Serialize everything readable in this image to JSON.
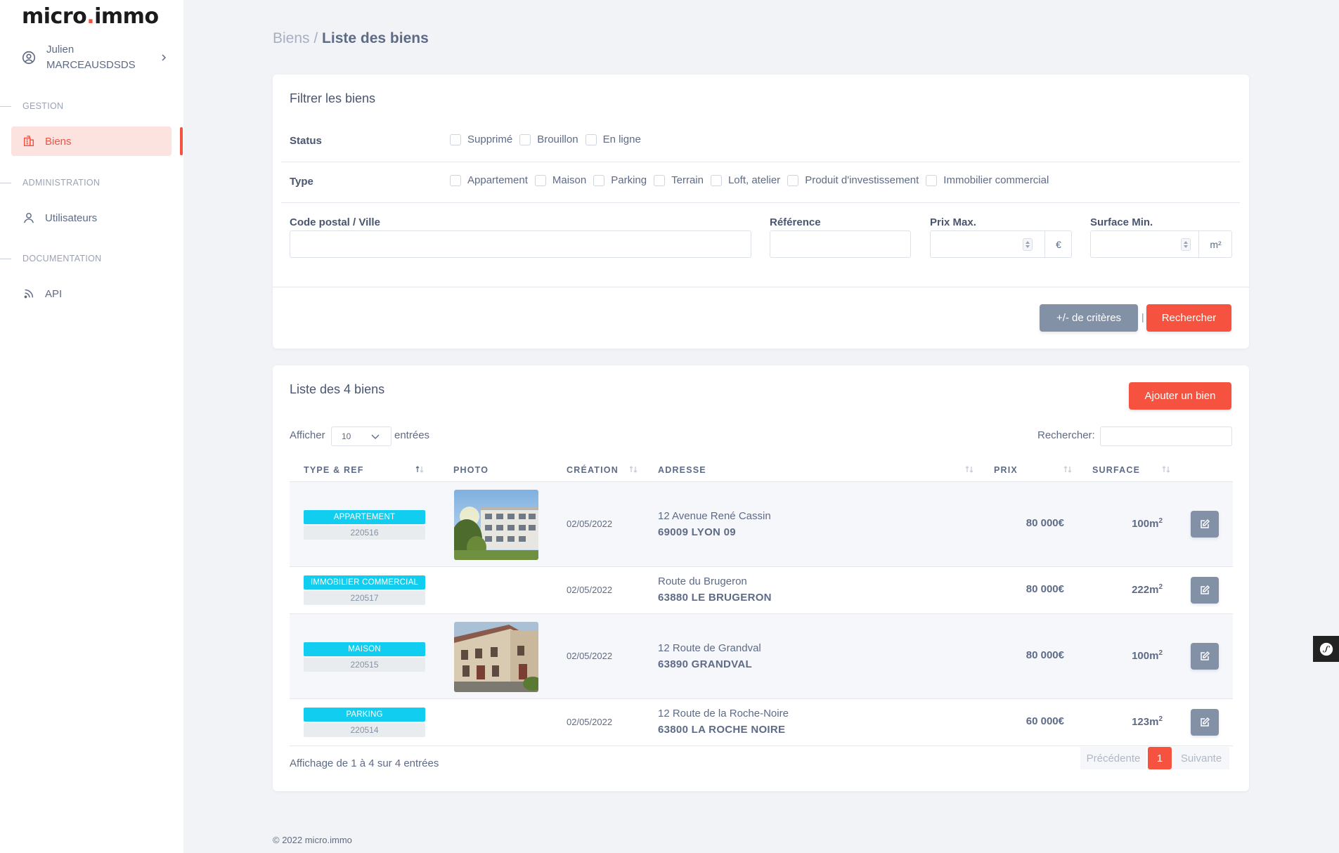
{
  "app": {
    "logo_main": "micro",
    "logo_dot": ".",
    "logo_tail": "immo"
  },
  "user": {
    "first_name": "Julien",
    "last_name": "MARCEAUSDSDS"
  },
  "sidebar": {
    "sections": [
      {
        "label": "GESTION"
      },
      {
        "label": "ADMINISTRATION"
      },
      {
        "label": "DOCUMENTATION"
      }
    ],
    "items": [
      {
        "label": "Biens",
        "icon": "building-icon",
        "active": true
      },
      {
        "label": "Utilisateurs",
        "icon": "user-icon",
        "active": false
      },
      {
        "label": "API",
        "icon": "rss-icon",
        "active": false
      }
    ]
  },
  "breadcrumb": {
    "parent": "Biens",
    "separator": " / ",
    "current": "Liste des biens"
  },
  "filters": {
    "title": "Filtrer les biens",
    "status_label": "Status",
    "status_options": [
      "Supprimé",
      "Brouillon",
      "En ligne"
    ],
    "type_label": "Type",
    "type_options": [
      "Appartement",
      "Maison",
      "Parking",
      "Terrain",
      "Loft, atelier",
      "Produit d'investissement",
      "Immobilier commercial"
    ],
    "postal_label": "Code postal / Ville",
    "postal_value": "",
    "reference_label": "Référence",
    "reference_value": "",
    "price_max_label": "Prix Max.",
    "price_max_value": "",
    "price_unit": "€",
    "surface_min_label": "Surface Min.",
    "surface_min_value": "",
    "surface_unit": "m²",
    "more_criteria_button": "+/- de critères",
    "separator": "|",
    "search_button": "Rechercher"
  },
  "list": {
    "title": "Liste des 4 biens",
    "add_button": "Ajouter un bien",
    "show_label": "Afficher",
    "page_size": "10",
    "entries_label": "entrées",
    "search_label": "Rechercher:",
    "search_value": "",
    "columns": [
      "TYPE & REF",
      "PHOTO",
      "CRÉATION",
      "ADRESSE",
      "PRIX",
      "SURFACE"
    ],
    "rows": [
      {
        "type": "APPARTEMENT",
        "ref": "220516",
        "has_photo": true,
        "photo": "apartment-building-photo",
        "date": "02/05/2022",
        "street": "12 Avenue René Cassin",
        "city": "69009 LYON 09",
        "price": "80 000€",
        "surface": "100m",
        "surface_exp": "2"
      },
      {
        "type": "IMMOBILIER COMMERCIAL",
        "ref": "220517",
        "has_photo": false,
        "date": "02/05/2022",
        "street": "Route du Brugeron",
        "city": "63880 LE BRUGERON",
        "price": "80 000€",
        "surface": "222m",
        "surface_exp": "2"
      },
      {
        "type": "MAISON",
        "ref": "220515",
        "has_photo": true,
        "photo": "house-photo",
        "date": "02/05/2022",
        "street": "12 Route de Grandval",
        "city": "63890 GRANDVAL",
        "price": "80 000€",
        "surface": "100m",
        "surface_exp": "2"
      },
      {
        "type": "PARKING",
        "ref": "220514",
        "has_photo": false,
        "date": "02/05/2022",
        "street": "12 Route de la Roche-Noire",
        "city": "63800 LA ROCHE NOIRE",
        "price": "60 000€",
        "surface": "123m",
        "surface_exp": "2"
      }
    ],
    "info": "Affichage de 1 à 4 sur 4 entrées",
    "pagination": {
      "prev": "Précédente",
      "current": "1",
      "next": "Suivante"
    }
  },
  "footer": {
    "text": "© 2022 micro.immo"
  },
  "colors": {
    "accent": "#f5523f",
    "badge": "#11cdef",
    "muted_button": "#8391a7"
  }
}
